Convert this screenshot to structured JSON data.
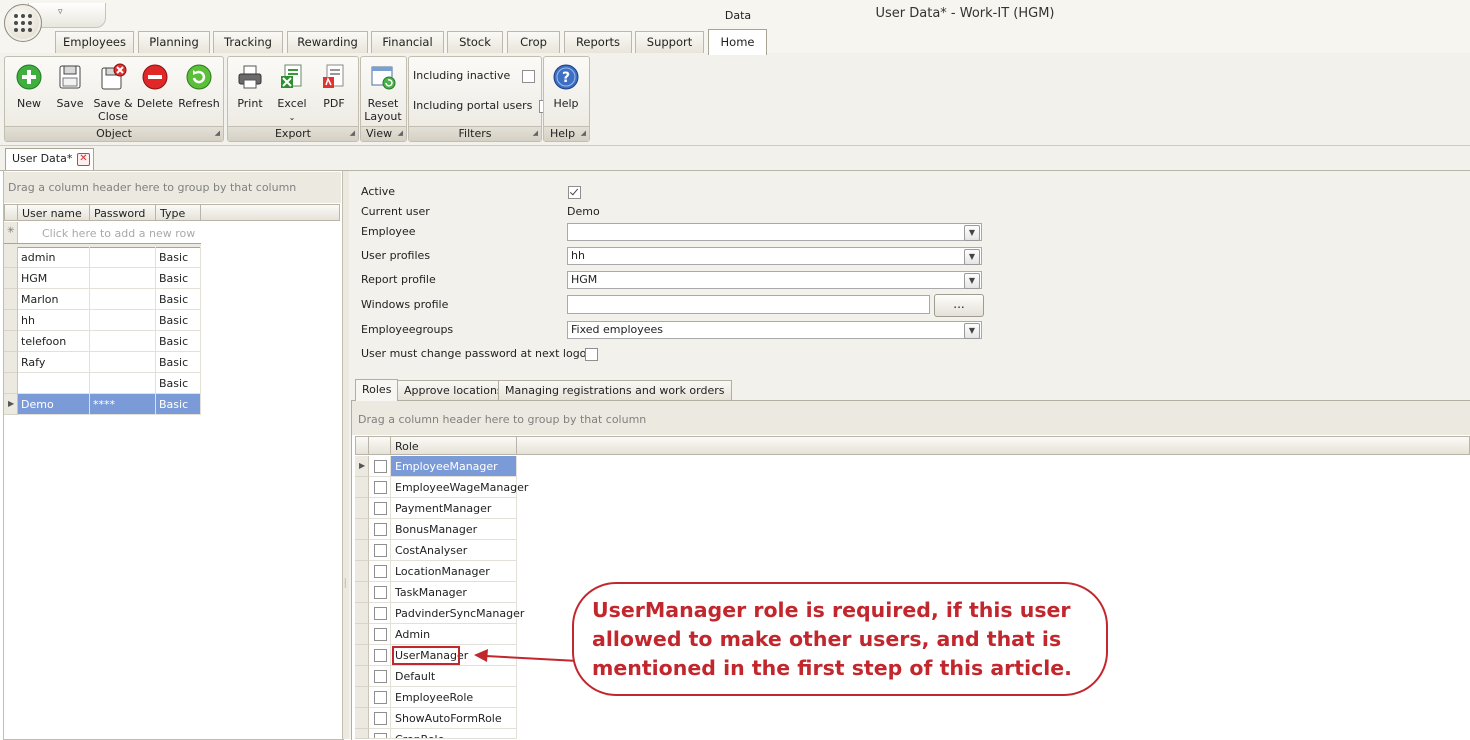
{
  "window": {
    "title": "User Data* - Work-IT (HGM)",
    "context_tab": "Data"
  },
  "ribbon_tabs": [
    "Employees",
    "Planning",
    "Tracking",
    "Rewarding",
    "Financial",
    "Stock",
    "Crop",
    "Reports",
    "Support",
    "Home"
  ],
  "ribbon_active_tab": "Home",
  "ribbon": {
    "object": {
      "caption": "Object",
      "new": "New",
      "save": "Save",
      "save_close_1": "Save &",
      "save_close_2": "Close",
      "delete": "Delete",
      "refresh": "Refresh"
    },
    "export": {
      "caption": "Export",
      "print": "Print",
      "excel": "Excel",
      "pdf": "PDF"
    },
    "view": {
      "caption": "View",
      "reset_1": "Reset",
      "reset_2": "Layout"
    },
    "filters": {
      "caption": "Filters",
      "including_inactive": "Including inactive",
      "including_portal": "Including portal users"
    },
    "help": {
      "caption": "Help",
      "help": "Help"
    }
  },
  "document_tab": {
    "label": "User Data*"
  },
  "users_grid": {
    "group_hint": "Drag a column header here to group by that column",
    "columns": [
      "User name",
      "Password",
      "Type"
    ],
    "new_row_hint": "Click here to add a new row",
    "rows": [
      {
        "username": "admin",
        "password": "",
        "type": "Basic"
      },
      {
        "username": "HGM",
        "password": "",
        "type": "Basic"
      },
      {
        "username": "Marlon",
        "password": "",
        "type": "Basic"
      },
      {
        "username": "hh",
        "password": "",
        "type": "Basic"
      },
      {
        "username": "telefoon",
        "password": "",
        "type": "Basic"
      },
      {
        "username": "Rafy",
        "password": "",
        "type": "Basic"
      },
      {
        "username": "",
        "password": "",
        "type": "Basic"
      },
      {
        "username": "Demo",
        "password": "****",
        "type": "Basic"
      }
    ],
    "selected_row": "Demo"
  },
  "form": {
    "active_label": "Active",
    "active_checked": true,
    "current_user_label": "Current user",
    "current_user_value": "Demo",
    "employee_label": "Employee",
    "employee_value": "",
    "user_profiles_label": "User profiles",
    "user_profiles_value": "hh",
    "report_profile_label": "Report profile",
    "report_profile_value": "HGM",
    "windows_profile_label": "Windows profile",
    "windows_profile_value": "",
    "ellipsis_label": "...",
    "employeegroups_label": "Employeegroups",
    "employeegroups_value": "Fixed employees",
    "must_change_label": "User must change password at next logon",
    "must_change_checked": false
  },
  "sub_tabs": [
    "Roles",
    "Approve locations",
    "Managing registrations and work orders"
  ],
  "roles_grid": {
    "group_hint": "Drag a column header here to group by that column",
    "column": "Role",
    "roles": [
      "EmployeeManager",
      "EmployeeWageManager",
      "PaymentManager",
      "BonusManager",
      "CostAnalyser",
      "LocationManager",
      "TaskManager",
      "PadvinderSyncManager",
      "Admin",
      "UserManager",
      "Default",
      "EmployeeRole",
      "ShowAutoFormRole",
      "CropRole"
    ],
    "selected_role": "EmployeeManager",
    "highlighted_role": "UserManager"
  },
  "annotation": {
    "text": "UserManager role is required, if this user allowed to make other users, and that is mentioned in the first step of this article.",
    "color": "#c1272d"
  },
  "colors": {
    "selection": "#7b9bd8",
    "accent_red": "#c1272d"
  }
}
